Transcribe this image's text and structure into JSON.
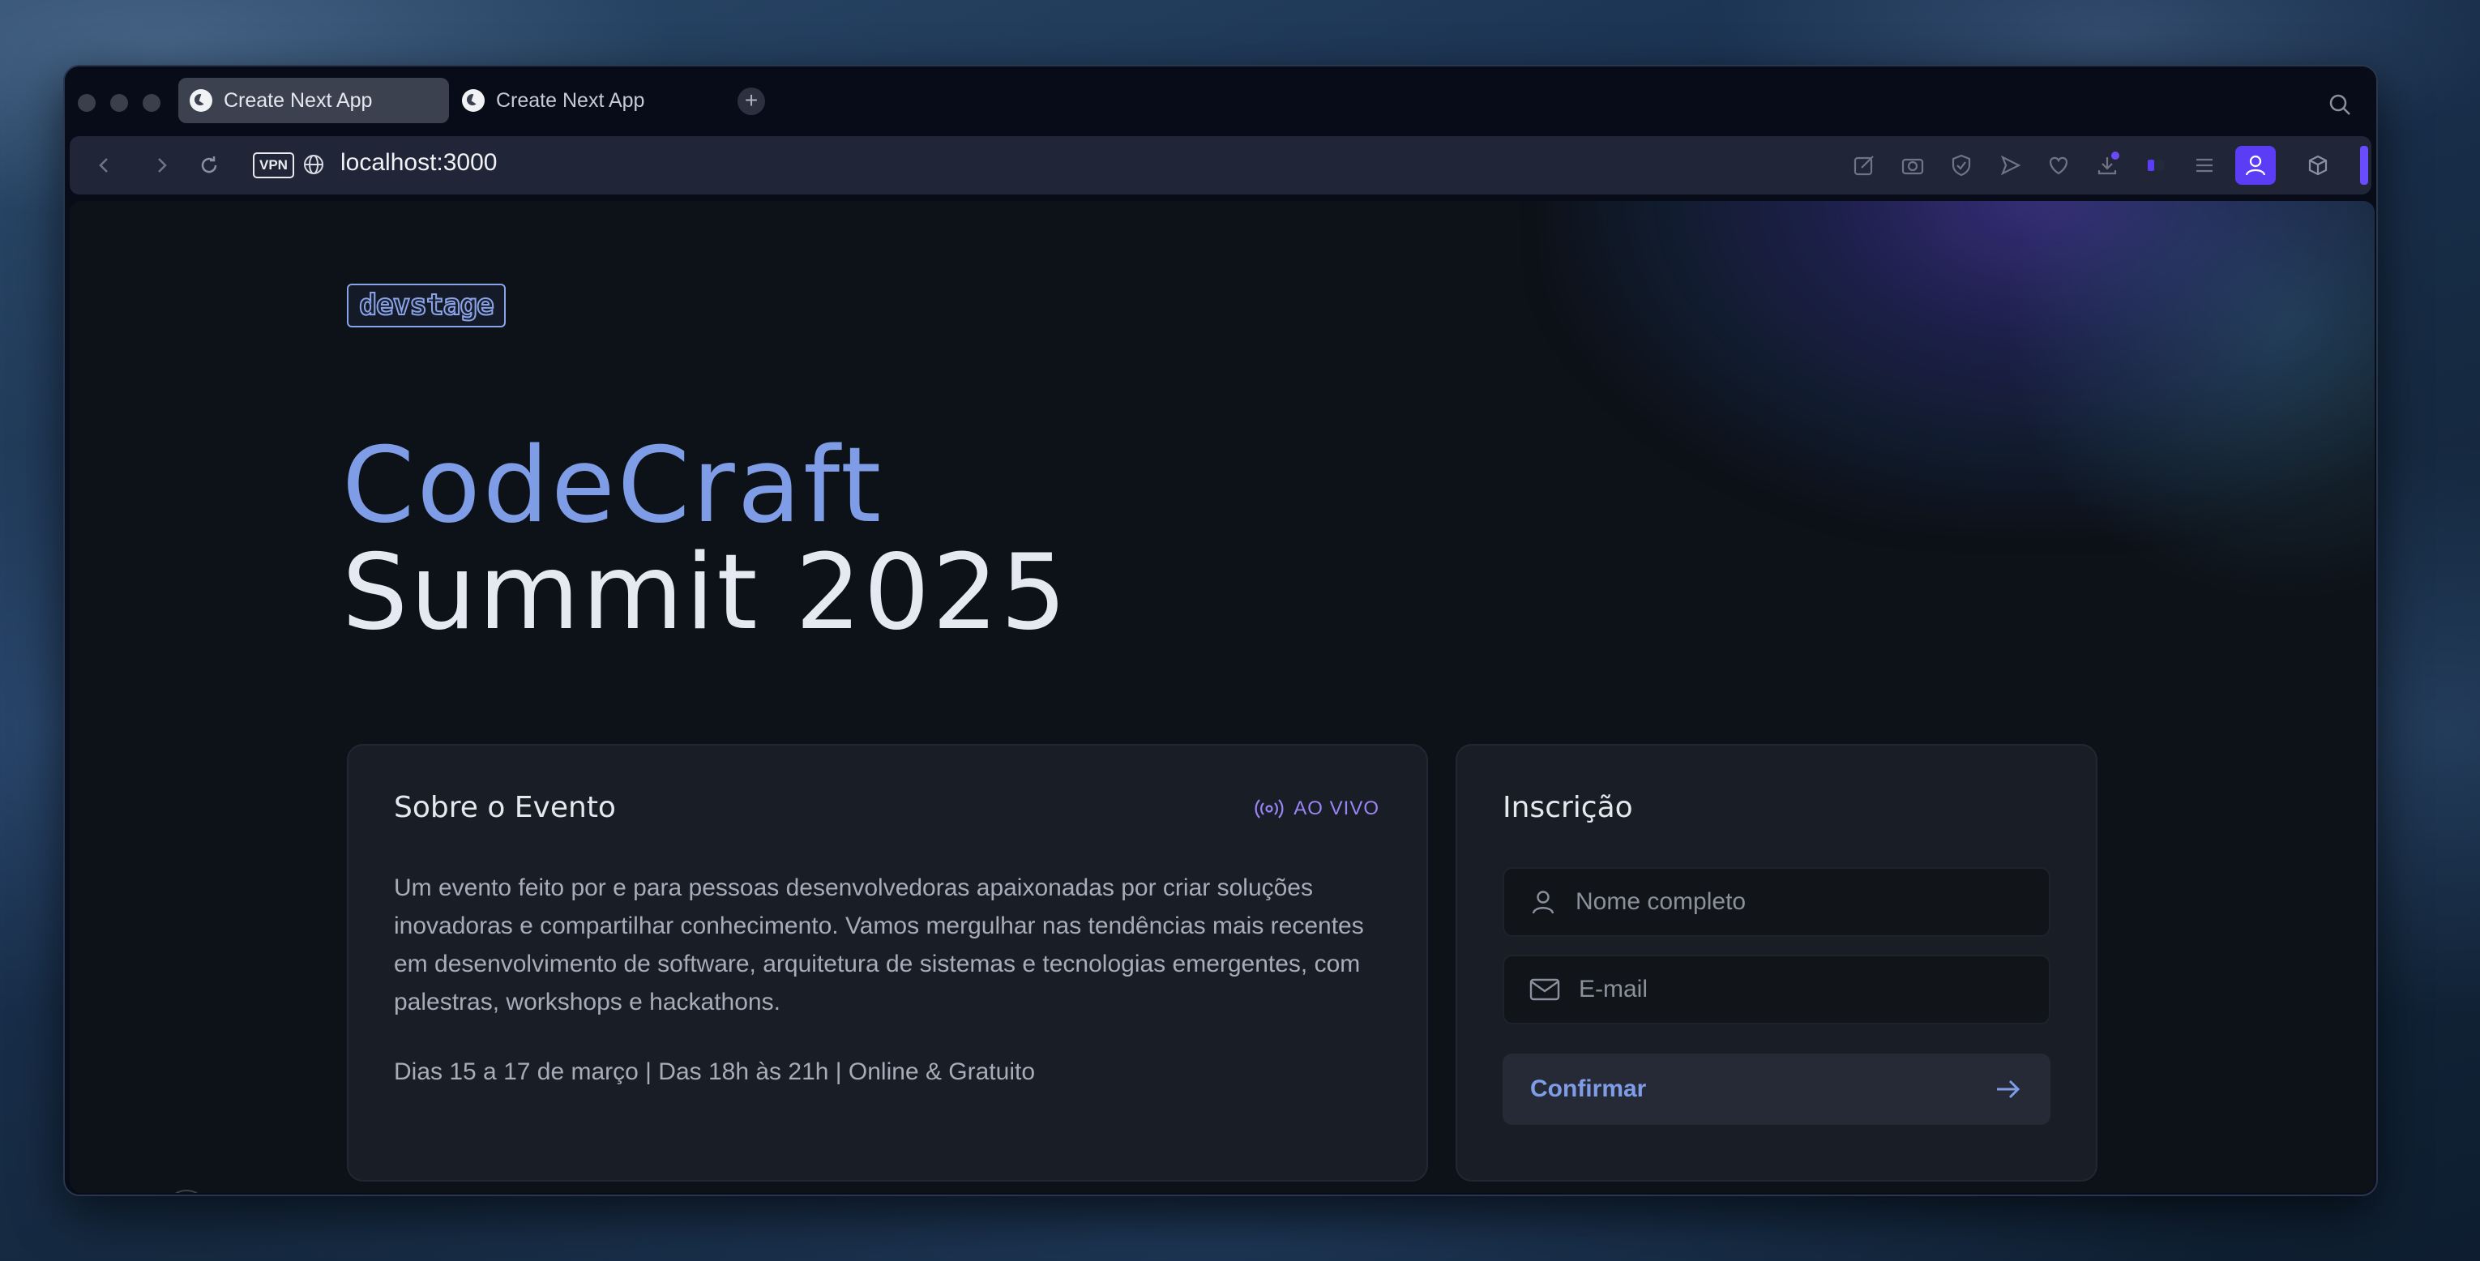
{
  "browser": {
    "tabs": [
      {
        "title": "Create Next App",
        "active": true
      },
      {
        "title": "Create Next App",
        "active": false
      }
    ],
    "new_tab_label": "+",
    "vpn_badge": "VPN",
    "url": "localhost:3000",
    "icons": [
      "back-icon",
      "forward-icon",
      "reload-icon",
      "globe-icon",
      "edit-icon",
      "camera-icon",
      "shield-icon",
      "send-icon",
      "heart-icon",
      "download-icon",
      "sidebar-icon",
      "menu-icon",
      "profile-icon",
      "cube-icon",
      "search-icon"
    ],
    "accent_color": "#5b3df5"
  },
  "page": {
    "logo_text": "devstage",
    "title_line1": "CodeCraft",
    "title_line2": "Summit 2025",
    "title_accent_color": "#7f9de6",
    "about": {
      "heading": "Sobre o Evento",
      "live_label": "AO VIVO",
      "description": "Um evento feito por e para pessoas desenvolvedoras apaixonadas por criar soluções inovadoras e compartilhar conhecimento. Vamos mergulhar nas tendências mais recentes em desenvolvimento de software, arquitetura de sistemas e tecnologias emergentes, com palestras, workshops e hackathons.",
      "details": "Dias 15 a 17 de março | Das 18h às 21h | Online & Gratuito"
    },
    "signup": {
      "heading": "Inscrição",
      "name_placeholder": "Nome completo",
      "email_placeholder": "E-mail",
      "confirm_label": "Confirmar"
    }
  }
}
